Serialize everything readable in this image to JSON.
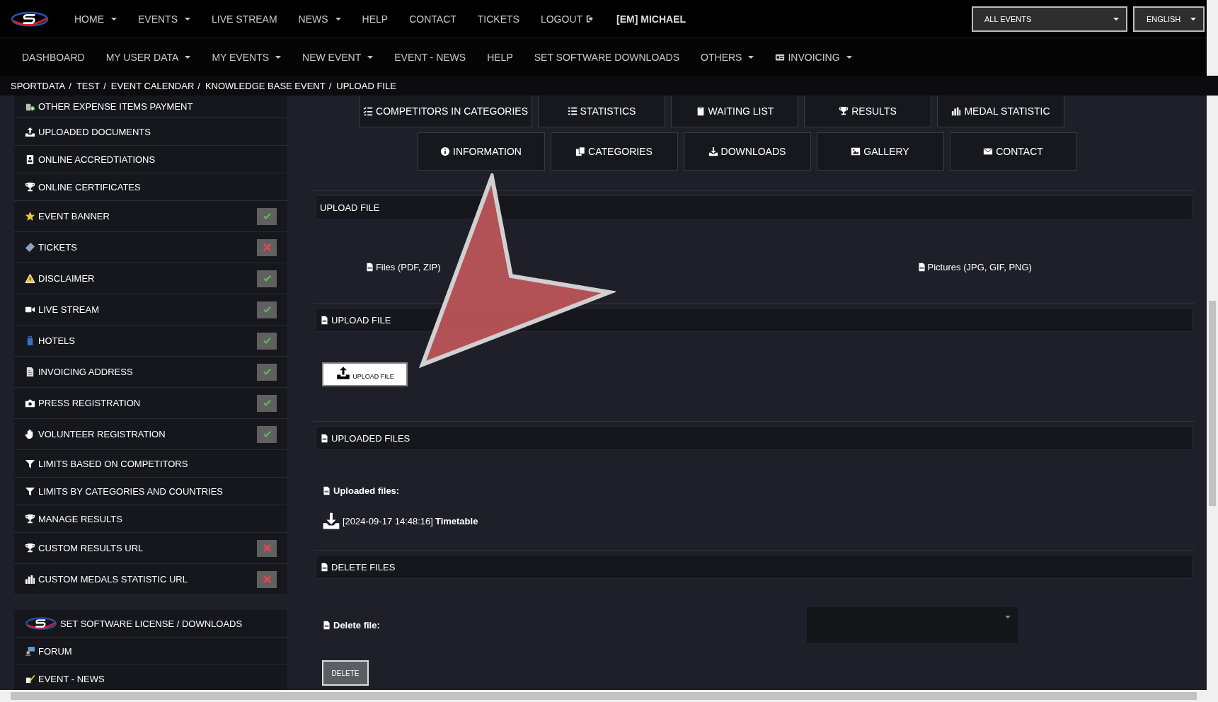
{
  "top_nav": {
    "items": [
      {
        "label": "HOME",
        "dropdown": true
      },
      {
        "label": "EVENTS",
        "dropdown": true
      },
      {
        "label": "LIVE STREAM",
        "dropdown": false
      },
      {
        "label": "NEWS",
        "dropdown": true
      },
      {
        "label": "HELP",
        "dropdown": false
      },
      {
        "label": "CONTACT",
        "dropdown": false
      },
      {
        "label": "TICKETS",
        "dropdown": false
      },
      {
        "label": "LOGOUT",
        "dropdown": false
      }
    ],
    "user": "[EM] MICHAEL"
  },
  "event_select": {
    "value": "ALL EVENTS"
  },
  "language_select": {
    "value": "ENGLISH"
  },
  "main_nav": {
    "items": [
      {
        "label": "DASHBOARD",
        "dropdown": false
      },
      {
        "label": "MY USER DATA",
        "dropdown": true
      },
      {
        "label": "MY EVENTS",
        "dropdown": true
      },
      {
        "label": "NEW EVENT",
        "dropdown": true
      },
      {
        "label": "EVENT - NEWS",
        "dropdown": false
      },
      {
        "label": "HELP",
        "dropdown": false
      },
      {
        "label": "SET SOFTWARE DOWNLOADS",
        "dropdown": false
      },
      {
        "label": "OTHERS",
        "dropdown": true
      },
      {
        "label": "INVOICING",
        "dropdown": true
      }
    ]
  },
  "breadcrumb": {
    "separator": "/",
    "items": [
      "SPORTDATA",
      "TEST",
      "EVENT CALENDAR",
      "KNOWLEDGE BASE EVENT",
      "UPLOAD FILE"
    ]
  },
  "sidebar": {
    "items": [
      {
        "label": "OTHER EXPENSE ITEMS PAYMENT"
      },
      {
        "label": "UPLOADED DOCUMENTS"
      },
      {
        "label": "ONLINE ACCREDTIATIONS"
      },
      {
        "label": "ONLINE CERTIFICATES"
      },
      {
        "label": "EVENT BANNER",
        "done": true
      },
      {
        "label": "TICKETS",
        "done": false
      },
      {
        "label": "DISCLAIMER",
        "done": true
      },
      {
        "label": "LIVE STREAM",
        "done": true
      },
      {
        "label": "HOTELS",
        "done": true
      },
      {
        "label": "INVOICING ADDRESS",
        "done": true
      },
      {
        "label": "PRESS REGISTRATION",
        "done": true
      },
      {
        "label": "VOLUNTEER REGISTRATION",
        "done": true
      },
      {
        "label": "LIMITS BASED ON COMPETITORS"
      },
      {
        "label": "LIMITS BY CATEGORIES AND COUNTRIES"
      },
      {
        "label": "MANAGE RESULTS"
      },
      {
        "label": "CUSTOM RESULTS URL",
        "done": false
      },
      {
        "label": "CUSTOM MEDALS STATISTIC URL",
        "done": false
      }
    ],
    "links": [
      {
        "label": "SET SOFTWARE LICENSE / DOWNLOADS"
      },
      {
        "label": "FORUM"
      },
      {
        "label": "EVENT - NEWS"
      }
    ]
  },
  "event_tabs": [
    [
      "COMPETITORS IN CATEGORIES",
      "STATISTICS",
      "WAITING LIST",
      "RESULTS",
      "MEDAL STATISTIC"
    ],
    [
      "INFORMATION",
      "CATEGORIES",
      "DOWNLOADS",
      "GALLERY",
      "CONTACT"
    ]
  ],
  "upload_type": {
    "title": "UPLOAD FILE",
    "options": [
      "Files (PDF, ZIP)",
      "Pictures (JPG, GIF, PNG)"
    ]
  },
  "upload": {
    "title": "UPLOAD FILE",
    "button": "UPLOAD FILE"
  },
  "uploaded": {
    "title": "UPLOADED FILES",
    "label": "Uploaded files:",
    "files": [
      {
        "timestamp": "[2024-09-17 14:48:16]",
        "name": "Timetable"
      }
    ]
  },
  "delete": {
    "title": "DELETE FILES",
    "label": "Delete file:",
    "button": "DELETE"
  }
}
